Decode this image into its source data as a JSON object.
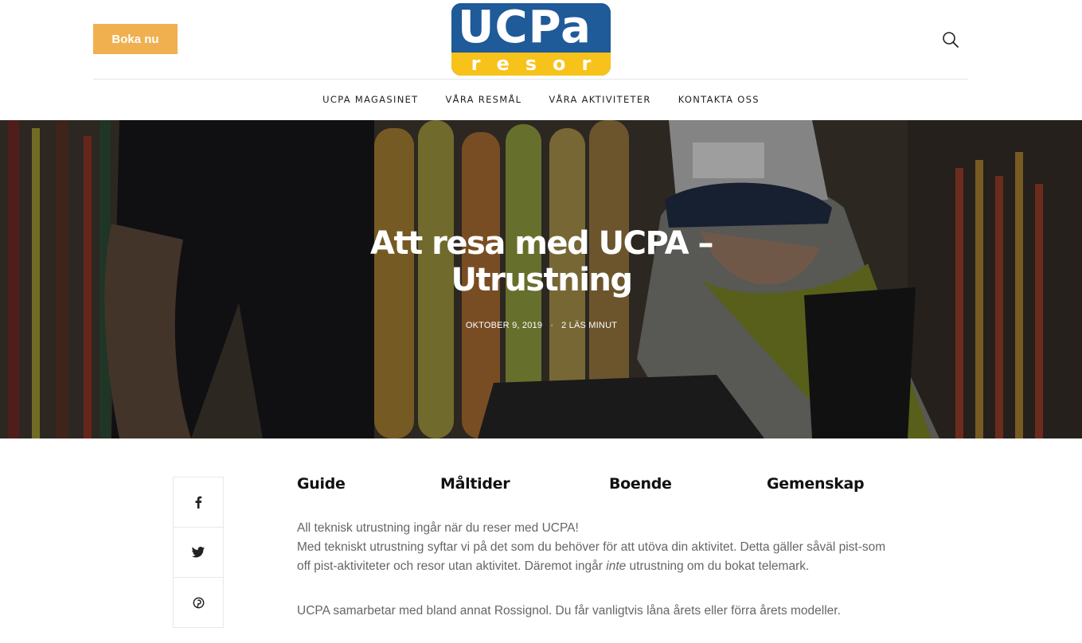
{
  "header": {
    "book_label": "Boka nu",
    "logo_top": "UCPa",
    "logo_bottom": "resor",
    "brand_blue": "#1f5a99",
    "brand_yellow": "#f7c219",
    "accent": "#f0b04f"
  },
  "nav": {
    "items": [
      {
        "label": "UCPA MAGASINET"
      },
      {
        "label": "VÅRA RESMÅL"
      },
      {
        "label": "VÅRA AKTIVITETER"
      },
      {
        "label": "KONTAKTA OSS"
      }
    ]
  },
  "hero": {
    "title_line1": "Att resa med UCPA –",
    "title_line2": "Utrustning",
    "date": "OKTOBER 9, 2019",
    "separator": "·",
    "read_time": "2 LÄS MINUT"
  },
  "share": {
    "icons": [
      "facebook-icon",
      "twitter-icon",
      "pinterest-icon"
    ]
  },
  "tabs": [
    {
      "label": "Guide"
    },
    {
      "label": "Måltider"
    },
    {
      "label": "Boende"
    },
    {
      "label": "Gemenskap"
    }
  ],
  "content": {
    "line1": "All teknisk utrustning ingår när du reser med UCPA!",
    "line2": "Med tekniskt utrustning syftar vi på det som du behöver för att utöva din aktivitet. Detta gäller såväl pist-som off pist-aktiviteter och resor utan aktivitet. Däremot ingår ",
    "line2_em": "inte",
    "line2_end": " utrustning om du bokat telemark.",
    "para2": "UCPA samarbetar med bland annat Rossignol. Du får vanligtvis låna årets eller förra årets modeller."
  }
}
